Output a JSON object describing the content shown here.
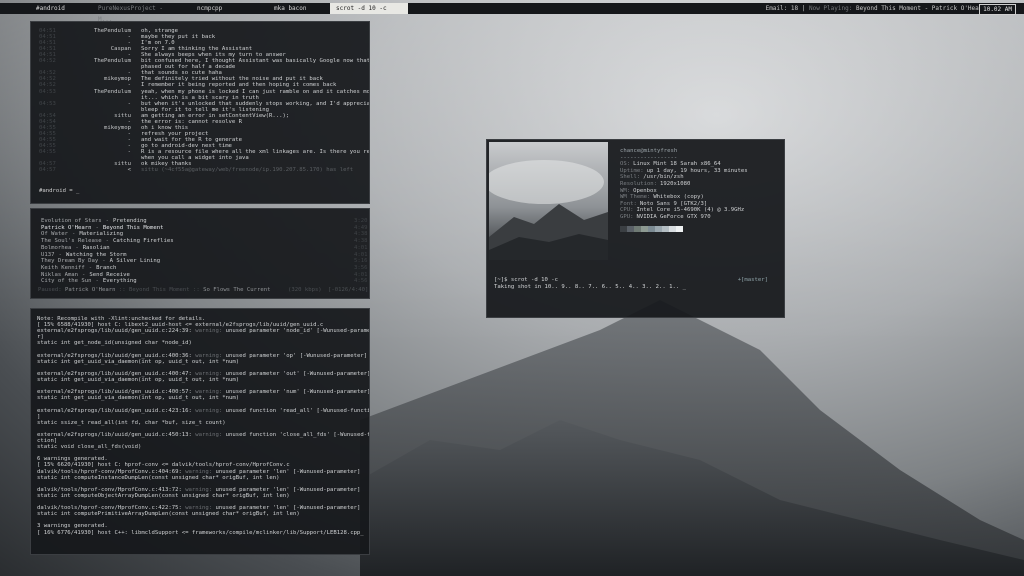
{
  "topbar": {
    "tabs": [
      {
        "label": "#android",
        "state": "normal"
      },
      {
        "label": "PureNexusProject - M...",
        "state": "dim"
      },
      {
        "label": "ncmpcpp",
        "state": "normal"
      },
      {
        "label": "mka bacon",
        "state": "normal"
      },
      {
        "label": "scrot -d 10 -c",
        "state": "active"
      }
    ],
    "email_label": "Email: 18",
    "separator": "|",
    "now_playing_label": "Now Playing:",
    "now_playing_value": "Beyond This Moment - Patrick O'Hearn",
    "clock": "10.02 AM"
  },
  "irc": {
    "messages": [
      {
        "time": "04:51",
        "nick": "ThePendulum",
        "msg": "oh, strange"
      },
      {
        "time": "04:51",
        "nick": "-",
        "msg": "maybe they put it back"
      },
      {
        "time": "04:51",
        "nick": "-",
        "msg": "I'm on 7.0"
      },
      {
        "time": "04:51",
        "nick": "Caspan",
        "msg": "Sorry I am thinking the Assistant"
      },
      {
        "time": "04:51",
        "nick": "-",
        "msg": "She always beeps when its my turn to answer"
      },
      {
        "time": "04:52",
        "nick": "ThePendulum",
        "msg": "bit confused here, I thought Assistant was basically Google now that's been"
      },
      {
        "time": "",
        "nick": "",
        "msg": "phased out for half a decade"
      },
      {
        "time": "04:52",
        "nick": "-",
        "msg": "that sounds so cute haha"
      },
      {
        "time": "04:52",
        "nick": "mikeymop",
        "msg": "The definitely tried without the noise and put it back"
      },
      {
        "time": "04:52",
        "nick": "-",
        "msg": "I remember it being reported and then hoping it comes back"
      },
      {
        "time": "04:53",
        "nick": "ThePendulum",
        "msg": "yeah, when my phone is locked I can just ramble on and it catches most of"
      },
      {
        "time": "",
        "nick": "",
        "msg": "it... which is a bit scary in truth"
      },
      {
        "time": "04:53",
        "nick": "-",
        "msg": "but when it's unlocked that suddenly stops working, and I'd appreciate the"
      },
      {
        "time": "",
        "nick": "",
        "msg": "bleep for it to tell me it's listening"
      },
      {
        "time": "04:54",
        "nick": "sittu",
        "msg": "am getting an error in setContentView(R...);"
      },
      {
        "time": "04:54",
        "nick": "-",
        "msg": "the error is: cannot resolve R"
      },
      {
        "time": "04:55",
        "nick": "mikeymop",
        "msg": "oh i know this"
      },
      {
        "time": "04:55",
        "nick": "-",
        "msg": "refresh your project"
      },
      {
        "time": "04:55",
        "nick": "-",
        "msg": "and wait for the R to generate"
      },
      {
        "time": "04:55",
        "nick": "-",
        "msg": "go to android-dev next time"
      },
      {
        "time": "04:55",
        "nick": "-",
        "msg": "R is a resource file where all the xml linkages are. Is there you refer too"
      },
      {
        "time": "",
        "nick": "",
        "msg": "when you call a widget into java"
      },
      {
        "time": "04:57",
        "nick": "sittu",
        "msg": "ok mikey thanks"
      },
      {
        "time": "04:57",
        "nick": "<",
        "msg": "sittu (~4cf55a@gateway/web/freenode/ip.190.207.85.170) has left"
      }
    ],
    "prompt": "#android = _"
  },
  "music": {
    "tracks": [
      {
        "artist": "Evolution of Stars",
        "title": "Pretending",
        "length": "3:20",
        "selected": false
      },
      {
        "artist": "Patrick O'Hearn",
        "title": "Beyond This Moment",
        "length": "4:49",
        "selected": true
      },
      {
        "artist": "Of Water",
        "title": "Materializing",
        "length": "4:38",
        "selected": false
      },
      {
        "artist": "The Soul's Release",
        "title": "Catching Fireflies",
        "length": "4:38",
        "selected": false
      },
      {
        "artist": "Bolmorhea",
        "title": "Rasolian",
        "length": "4:01",
        "selected": false
      },
      {
        "artist": "U137",
        "title": "Watching the Storm",
        "length": "4:01",
        "selected": false
      },
      {
        "artist": "They Dream By Day",
        "title": "A Silver Lining",
        "length": "5:16",
        "selected": false
      },
      {
        "artist": "Keith Kenniff",
        "title": "Branch",
        "length": "3:56",
        "selected": false
      },
      {
        "artist": "Niklas Aman",
        "title": "Send Receive",
        "length": "4:01",
        "selected": false
      },
      {
        "artist": "City of the Sun",
        "title": "Everything",
        "length": "4:56",
        "selected": false
      }
    ],
    "separator": "-",
    "status": {
      "state": "Paused:",
      "artist": "Patrick O'Hearn",
      "sep1": "::",
      "album": "Beyond This Moment",
      "sep2": "::",
      "song": "So Flows The Current",
      "bitrate": "(320 kbps)",
      "time": "[-0126/4:40]"
    }
  },
  "compile": {
    "lines": [
      {
        "text": "Note: Recompile with -Xlint:unchecked for details.",
        "warn": ""
      },
      {
        "text": "[ 15% 6588/41930] host C: libext2_uuid-host <= external/e2fsprogs/lib/uuid/gen_uuid.c",
        "warn": ""
      },
      {
        "text": "external/e2fsprogs/lib/uuid/gen_uuid.c:224:39: ",
        "warn": "warning:",
        "rest": " unused parameter 'node_id' [-Wunused-paramete"
      },
      {
        "text": "r]",
        "warn": ""
      },
      {
        "text": "static int get_node_id(unsigned char *node_id)",
        "warn": ""
      },
      {
        "text": "",
        "warn": ""
      },
      {
        "text": "external/e2fsprogs/lib/uuid/gen_uuid.c:400:36: ",
        "warn": "warning:",
        "rest": " unused parameter 'op' [-Wunused-parameter]"
      },
      {
        "text": "static int get_uuid_via_daemon(int op, uuid_t out, int *num)",
        "warn": ""
      },
      {
        "text": "",
        "warn": ""
      },
      {
        "text": "external/e2fsprogs/lib/uuid/gen_uuid.c:400:47: ",
        "warn": "warning:",
        "rest": " unused parameter 'out' [-Wunused-parameter]"
      },
      {
        "text": "static int get_uuid_via_daemon(int op, uuid_t out, int *num)",
        "warn": ""
      },
      {
        "text": "",
        "warn": ""
      },
      {
        "text": "external/e2fsprogs/lib/uuid/gen_uuid.c:400:57: ",
        "warn": "warning:",
        "rest": " unused parameter 'num' [-Wunused-parameter]"
      },
      {
        "text": "static int get_uuid_via_daemon(int op, uuid_t out, int *num)",
        "warn": ""
      },
      {
        "text": "",
        "warn": ""
      },
      {
        "text": "external/e2fsprogs/lib/uuid/gen_uuid.c:423:16: ",
        "warn": "warning:",
        "rest": " unused function 'read_all' [-Wunused-function"
      },
      {
        "text": "]",
        "warn": ""
      },
      {
        "text": "static ssize_t read_all(int fd, char *buf, size_t count)",
        "warn": ""
      },
      {
        "text": "",
        "warn": ""
      },
      {
        "text": "external/e2fsprogs/lib/uuid/gen_uuid.c:450:13: ",
        "warn": "warning:",
        "rest": " unused function 'close_all_fds' [-Wunused-fun"
      },
      {
        "text": "ction]",
        "warn": ""
      },
      {
        "text": "static void close_all_fds(void)",
        "warn": ""
      },
      {
        "text": "",
        "warn": ""
      },
      {
        "text": "6 warnings generated.",
        "warn": ""
      },
      {
        "text": "[ 15% 6620/41930] host C: hprof-conv <= dalvik/tools/hprof-conv/HprofConv.c",
        "warn": ""
      },
      {
        "text": "dalvik/tools/hprof-conv/HprofConv.c:404:69: ",
        "warn": "warning:",
        "rest": " unused parameter 'len' [-Wunused-parameter]"
      },
      {
        "text": "static int computeInstanceDumpLen(const unsigned char* origBuf, int len)",
        "warn": ""
      },
      {
        "text": "",
        "warn": ""
      },
      {
        "text": "dalvik/tools/hprof-conv/HprofConv.c:413:72: ",
        "warn": "warning:",
        "rest": " unused parameter 'len' [-Wunused-parameter]"
      },
      {
        "text": "static int computeObjectArrayDumpLen(const unsigned char* origBuf, int len)",
        "warn": ""
      },
      {
        "text": "",
        "warn": ""
      },
      {
        "text": "dalvik/tools/hprof-conv/HprofConv.c:422:75: ",
        "warn": "warning:",
        "rest": " unused parameter 'len' [-Wunused-parameter]"
      },
      {
        "text": "static int computePrimitiveArrayDumpLen(const unsigned char* origBuf, int len)",
        "warn": ""
      },
      {
        "text": "",
        "warn": ""
      },
      {
        "text": "3 warnings generated.",
        "warn": ""
      },
      {
        "text": "[ 16% 6776/41930] host C++: libmcldSupport <= frameworks/compile/mclinker/lib/Support/LEB128.cpp_",
        "warn": ""
      }
    ]
  },
  "neofetch": {
    "title": "chance@mintyfresh",
    "underline": "-----------------",
    "info": [
      {
        "key": "OS:",
        "value": "Linux Mint 18 Sarah x86_64"
      },
      {
        "key": "Uptime:",
        "value": "up 1 day, 19 hours, 33 minutes"
      },
      {
        "key": "Shell:",
        "value": "/usr/bin/zsh"
      },
      {
        "key": "Resolution:",
        "value": "1920x1080"
      },
      {
        "key": "WM:",
        "value": "Openbox"
      },
      {
        "key": "WM Theme:",
        "value": "Whitebox (copy)"
      },
      {
        "key": "Font:",
        "value": "Noto Sans 9 [GTK2/3]"
      },
      {
        "key": "CPU:",
        "value": "Intel Core i5-4690K (4) @ 3.9GHz"
      },
      {
        "key": "GPU:",
        "value": "NVIDIA GeForce GTX 970"
      }
    ],
    "swatches": [
      "#3b3f43",
      "#5a6067",
      "#6f7a74",
      "#8d9a92",
      "#7c8b93",
      "#9aa7ae",
      "#b4bec3",
      "#d8dde0",
      "#eef1f2"
    ],
    "prompt": "[~]$ scrot -d 10 -c",
    "countdown": "Taking shot in 10.. 9.. 8.. 7.. 6.. 5.. 4.. 3.. 2.. 1.. _",
    "branch": "+[master]"
  }
}
